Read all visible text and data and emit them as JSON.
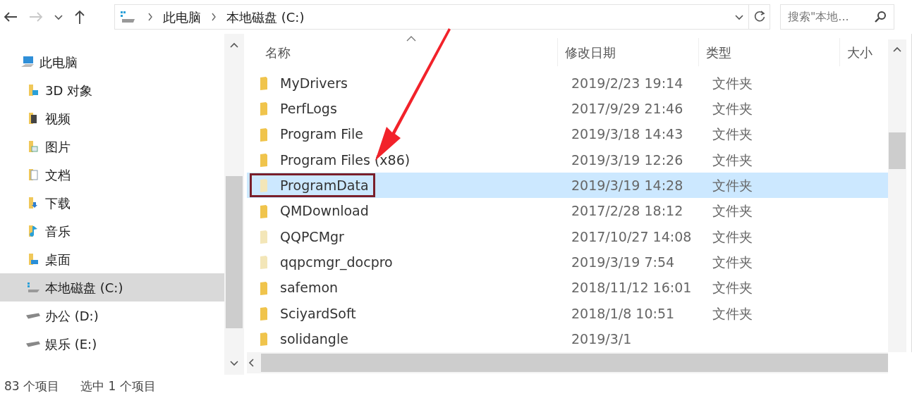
{
  "nav": {
    "breadcrumb": [
      "此电脑",
      "本地磁盘 (C:)"
    ],
    "search": {
      "placeholder": "搜索\"本地..."
    }
  },
  "sidebar": {
    "items": [
      {
        "label": "此电脑",
        "kind": "pc",
        "selected": false,
        "children": [
          {
            "label": "3D 对象",
            "kind": "objects",
            "selected": false
          },
          {
            "label": "视频",
            "kind": "video",
            "selected": false
          },
          {
            "label": "图片",
            "kind": "pictures",
            "selected": false
          },
          {
            "label": "文档",
            "kind": "documents",
            "selected": false
          },
          {
            "label": "下载",
            "kind": "downloads",
            "selected": false
          },
          {
            "label": "音乐",
            "kind": "music",
            "selected": false
          },
          {
            "label": "桌面",
            "kind": "desktop",
            "selected": false
          },
          {
            "label": "本地磁盘 (C:)",
            "kind": "system-drive",
            "selected": true
          },
          {
            "label": "办公 (D:)",
            "kind": "drive",
            "selected": false
          },
          {
            "label": "娱乐 (E:)",
            "kind": "drive",
            "selected": false
          }
        ]
      }
    ]
  },
  "table": {
    "columns": [
      "名称",
      "修改日期",
      "类型",
      "大小"
    ],
    "rows": [
      {
        "name": "MyDrivers",
        "date": "2019/2/23 19:14",
        "type": "文件夹",
        "selected": false,
        "faded": false,
        "annotated": false
      },
      {
        "name": "PerfLogs",
        "date": "2017/9/29 21:46",
        "type": "文件夹",
        "selected": false,
        "faded": false,
        "annotated": false
      },
      {
        "name": "Program File",
        "date": "2019/3/18 14:43",
        "type": "文件夹",
        "selected": false,
        "faded": false,
        "annotated": false
      },
      {
        "name": "Program Files (x86)",
        "date": "2019/3/19 12:26",
        "type": "文件夹",
        "selected": false,
        "faded": false,
        "annotated": false
      },
      {
        "name": "ProgramData",
        "date": "2019/3/19 14:28",
        "type": "文件夹",
        "selected": true,
        "faded": true,
        "annotated": true
      },
      {
        "name": "QMDownload",
        "date": "2017/2/28 18:12",
        "type": "文件夹",
        "selected": false,
        "faded": false,
        "annotated": false
      },
      {
        "name": "QQPCMgr",
        "date": "2017/10/27 14:08",
        "type": "文件夹",
        "selected": false,
        "faded": true,
        "annotated": false
      },
      {
        "name": "qqpcmgr_docpro",
        "date": "2019/3/19 7:54",
        "type": "文件夹",
        "selected": false,
        "faded": true,
        "annotated": false
      },
      {
        "name": "safemon",
        "date": "2018/11/12 16:01",
        "type": "文件夹",
        "selected": false,
        "faded": false,
        "annotated": false
      },
      {
        "name": "SciyardSoft",
        "date": "2018/1/8 10:51",
        "type": "文件夹",
        "selected": false,
        "faded": false,
        "annotated": false
      },
      {
        "name": "solidangle",
        "date": "2019/3/1",
        "selected": false,
        "faded": false,
        "annotated": false
      }
    ]
  },
  "status_bar": {
    "count": "83 个项目",
    "selection": "选中 1 个项目"
  }
}
